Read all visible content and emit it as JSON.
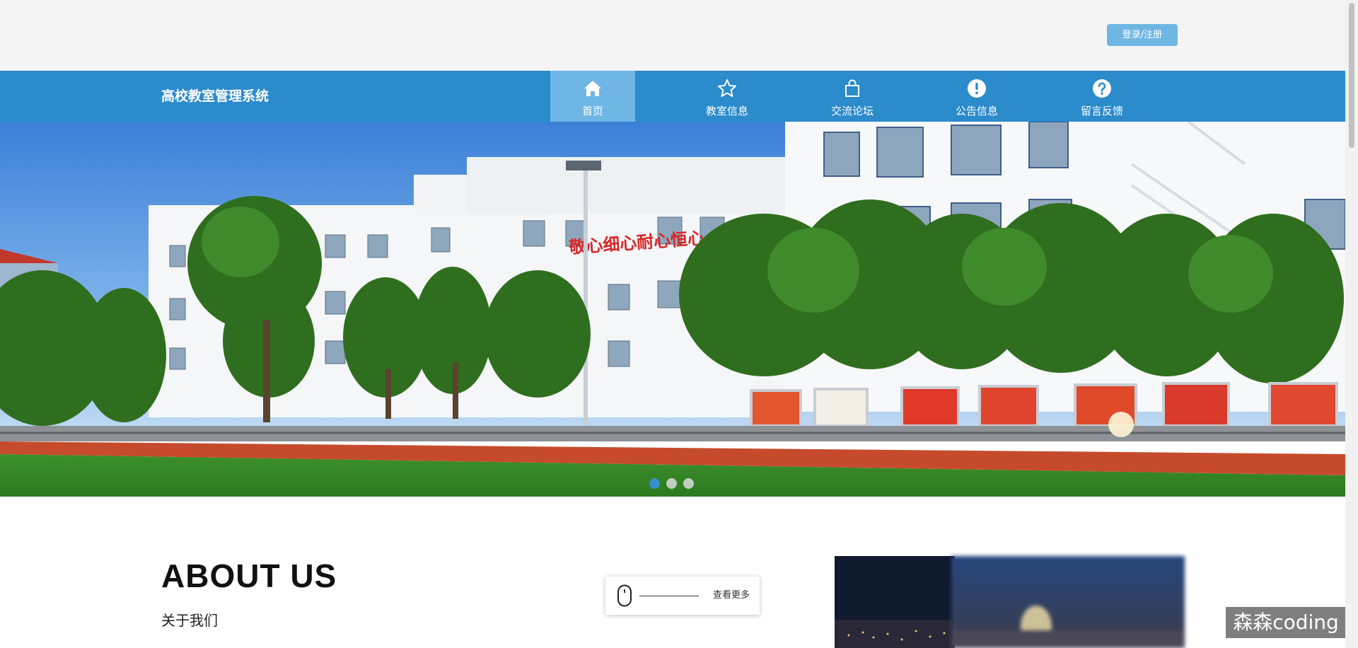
{
  "topbar": {
    "login_label": "登录/注册"
  },
  "navbar": {
    "site_title": "高校教室管理系统",
    "items": [
      {
        "label": "首页",
        "icon": "home-icon",
        "active": true
      },
      {
        "label": "教室信息",
        "icon": "star-icon",
        "active": false
      },
      {
        "label": "交流论坛",
        "icon": "shopping-bag-icon",
        "active": false
      },
      {
        "label": "公告信息",
        "icon": "exclamation-circle-icon",
        "active": false
      },
      {
        "label": "留言反馈",
        "icon": "question-circle-icon",
        "active": false
      }
    ]
  },
  "hero": {
    "slide_count": 3,
    "active_slide": 1,
    "building_slogan": "敬心细心耐心恒心"
  },
  "about": {
    "title": "ABOUT US",
    "subtitle": "关于我们",
    "more_label": "查看更多"
  },
  "watermark": "森森coding",
  "colors": {
    "nav_bg": "#2b8bcb",
    "nav_active": "#6fb6e4",
    "login_button": "#6eb7e3",
    "dot_active": "#3a8fd0"
  }
}
